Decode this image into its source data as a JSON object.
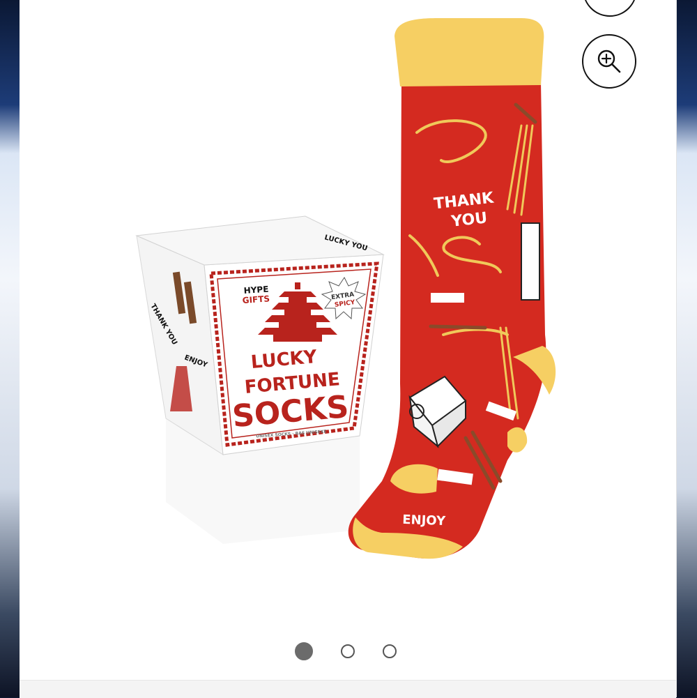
{
  "product": {
    "box_brand_line1": "HYPE",
    "box_brand_line2": "GIFTS",
    "box_badge_line1": "EXTRA",
    "box_badge_line2": "SPICY",
    "box_title_line1": "LUCKY",
    "box_title_line2": "FORTUNE",
    "box_title_line3": "SOCKS",
    "box_subtitle": "UNISEX SOCKS · BAS UNISEXE",
    "box_side_text": "THANK YOU",
    "box_side_text2": "ENJOY",
    "box_lid_text": "LUCKY YOU",
    "sock_text_1_line1": "THANK",
    "sock_text_1_line2": "YOU",
    "sock_text_2": "ENJOY",
    "colors": {
      "sock_red": "#d42a20",
      "sock_yellow": "#f6cf63",
      "box_red": "#b8231d"
    }
  },
  "actions": {
    "wishlist_icon": "heart-icon",
    "zoom_icon": "zoom-in-icon"
  },
  "carousel": {
    "total_slides": 3,
    "active_index": 1
  }
}
